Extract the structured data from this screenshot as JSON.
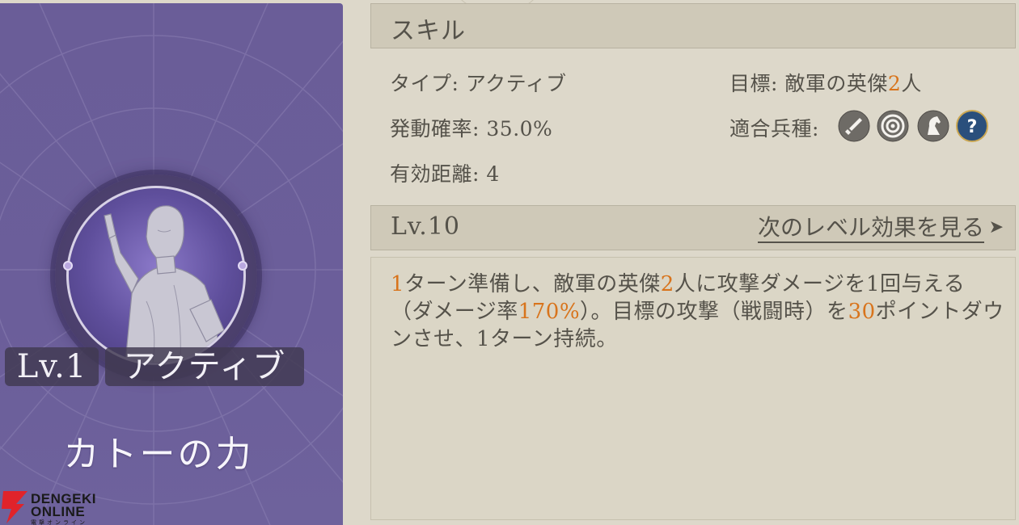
{
  "card": {
    "level_label": "Lv.1",
    "type_label": "アクティブ",
    "skill_name": "カトーの力",
    "colors": {
      "background": "#6a5d98",
      "tag_bg": "#413950"
    }
  },
  "watermark": {
    "line1": "DENGEKI",
    "line2": "ONLINE",
    "line3": "電撃オンライン",
    "icon": "lightning-bolt-icon"
  },
  "skill_section": {
    "title": "スキル",
    "type_label": "タイプ:",
    "type_value": "アクティブ",
    "chance_label": "発動確率:",
    "chance_value": "35.0%",
    "range_label": "有効距離:",
    "range_value": "4",
    "target_label": "目標:",
    "target_prefix": "敵軍の英傑",
    "target_count": "2",
    "target_suffix": "人",
    "units_label": "適合兵種:",
    "unit_icons": [
      "sword-icon",
      "archery-target-icon",
      "horse-icon",
      "question-mark-icon"
    ]
  },
  "level_section": {
    "level_label": "Lv.10",
    "next_level_link": "次のレベル効果を見る",
    "next_arrow_icon": "arrow-right-icon"
  },
  "description": {
    "segments": [
      {
        "text": "1",
        "highlight": true
      },
      {
        "text": "ターン準備し、敵軍の英傑",
        "highlight": false
      },
      {
        "text": "2",
        "highlight": true
      },
      {
        "text": "人に攻撃ダメージを1回与える（ダメージ率",
        "highlight": false
      },
      {
        "text": "170%",
        "highlight": true
      },
      {
        "text": "）。目標の攻撃（戦闘時）を",
        "highlight": false
      },
      {
        "text": "30",
        "highlight": true
      },
      {
        "text": "ポイントダウンさせ、1ターン持続。",
        "highlight": false
      }
    ]
  },
  "colors": {
    "highlight": "#d8741c",
    "panel_bg": "#ddd8ca",
    "header_bg": "#cfc9b8",
    "text": "#55524a"
  }
}
